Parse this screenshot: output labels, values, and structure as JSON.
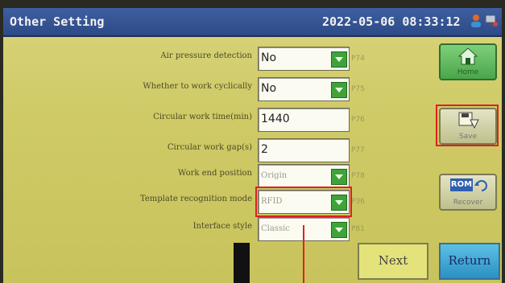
{
  "titlebar": {
    "title": "Other Setting",
    "datetime": "2022-05-06 08:33:12",
    "icons": [
      "user-icon",
      "network-icon"
    ]
  },
  "settings": [
    {
      "label": "Air pressure detection",
      "value": "No",
      "param": "P74",
      "style": "normal",
      "has_dropdown": true
    },
    {
      "label": "Whether to work cyclically",
      "value": "No",
      "param": "P75",
      "style": "normal",
      "has_dropdown": true
    },
    {
      "label": "Circular work time(min)",
      "value": "1440",
      "param": "P76",
      "style": "normal",
      "has_dropdown": false
    },
    {
      "label": "Circular work gap(s)",
      "value": "2",
      "param": "P77",
      "style": "normal",
      "has_dropdown": false
    },
    {
      "label": "Work end position",
      "value": "Origin",
      "param": "P78",
      "style": "dim",
      "has_dropdown": true
    },
    {
      "label": "Template recognition mode",
      "value": "RFID",
      "param": "P36",
      "style": "dim",
      "has_dropdown": true
    },
    {
      "label": "Interface style",
      "value": "Classic",
      "param": "P81",
      "style": "dim",
      "has_dropdown": true
    }
  ],
  "buttons": {
    "home": "Home",
    "save": "Save",
    "recover": "Recover",
    "rom": "ROM",
    "next": "Next",
    "return": "Return"
  },
  "colors": {
    "accent_green": "#3fa33a",
    "titlebar": "#2d4a86",
    "highlight": "#e02020"
  }
}
